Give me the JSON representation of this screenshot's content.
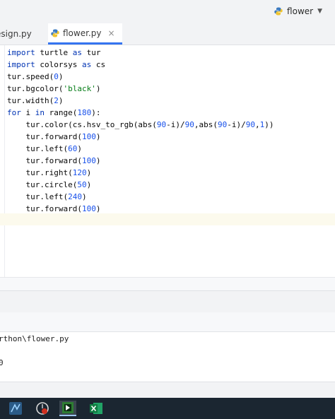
{
  "run_config": {
    "label": "flower",
    "icon": "python-icon"
  },
  "tabs": [
    {
      "label": "esign.py",
      "active": false
    },
    {
      "label": "flower.py",
      "active": true,
      "close": "×"
    }
  ],
  "code_lines": [
    "import turtle as tur",
    "import colorsys as cs",
    "tur.speed(0)",
    "tur.bgcolor('black')",
    "tur.width(2)",
    "for i in range(180):",
    "    tur.color(cs.hsv_to_rgb(abs(90-i)/90,abs(90-i)/90,1))",
    "    tur.forward(100)",
    "    tur.left(60)",
    "    tur.forward(100)",
    "    tur.right(120)",
    "    tur.circle(50)",
    "    tur.left(240)",
    "    tur.forward(100)"
  ],
  "console": {
    "path_line": "rthon\\flower.py",
    "exit_line": "0"
  },
  "taskbar": {
    "icons": [
      "pycharm-icon",
      "media-icon",
      "python-turtle-icon",
      "excel-icon"
    ]
  },
  "colors": {
    "keyword": "#0033b3",
    "number": "#1750eb",
    "string": "#067d17",
    "accent": "#3574f0"
  }
}
